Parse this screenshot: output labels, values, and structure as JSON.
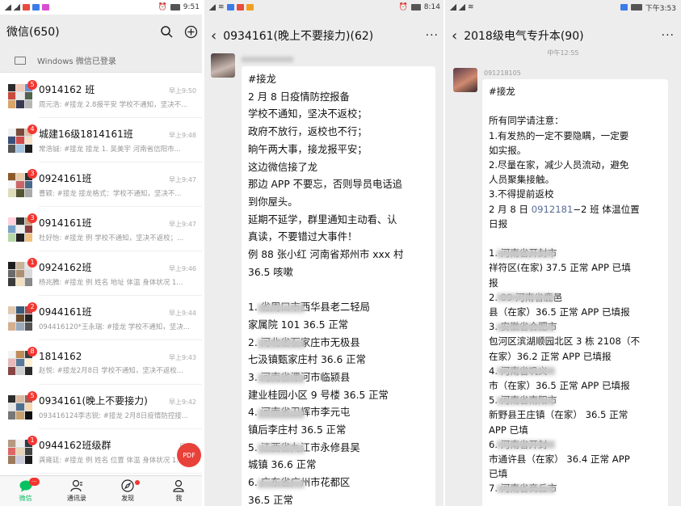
{
  "panel1": {
    "status_time": "9:51",
    "title": "微信(650)",
    "login_text": "Windows 微信已登录",
    "pdf_label": "PDF",
    "chats": [
      {
        "name": "0914162 班",
        "time": "早上9:50",
        "badge": "5",
        "preview": "周元浩: #接龙 2.8报平安 学校不通知，坚决不..."
      },
      {
        "name": "城建16级1814161班",
        "time": "早上9:48",
        "badge": "4",
        "preview": "常浩铖: #接龙 接龙 1. 吴美宇 河南省信阳市..."
      },
      {
        "name": "0924161班",
        "time": "早上9:47",
        "badge": "3",
        "preview": "曹颖: #接龙 接龙格式：学校不通知，坚决不..."
      },
      {
        "name": "0914161班",
        "time": "早上9:47",
        "badge": "3",
        "preview": "杜好怡: #接龙 例 学校不通知，坚决不返校；..."
      },
      {
        "name": "0924162班",
        "time": "早上9:46",
        "badge": "1",
        "preview": "杨兆腾: #接龙 例 姓名 地址 体温 身体状况 1..."
      },
      {
        "name": "0944161班",
        "time": "早上9:44",
        "badge": "2",
        "preview": "094416120*王永瑞: #接龙 学校不通知，坚决..."
      },
      {
        "name": "1814162",
        "time": "早上9:43",
        "badge": "8",
        "preview": "赵悦: #接龙2月8日 学校不通知，坚决不返校..."
      },
      {
        "name": "0934161(晚上不要接力)",
        "time": "早上9:42",
        "badge": "5",
        "preview": "093416124李志锐: #接龙 2月8日疫情防控接..."
      },
      {
        "name": "0944162班级群",
        "time": "早上9",
        "badge": "1",
        "preview": "龚雍廷: #接龙 例 姓名 位置 体温 身体状况 1..."
      }
    ],
    "tabs": [
      {
        "label": "微信",
        "badge": "···"
      },
      {
        "label": "通讯录"
      },
      {
        "label": "发现"
      },
      {
        "label": "我"
      }
    ]
  },
  "panel2": {
    "status_time": "8:14",
    "title": "0934161(晚上不要接力)(62)",
    "more": "···",
    "lines": [
      "#接龙",
      "2 月 8 日疫情防控报备",
      "学校不通知，坚决不返校；",
      "政府不放行，返校也不行；",
      "晌午两大事，接龙报平安；",
      "这边微信接了龙",
      "那边 APP 不要忘，否则导员电话追",
      "到你屋头。",
      "延期不延学，群里通知主动看、认",
      "真读，不要错过大事件！",
      "例 88 张小红 河南省郑州市 xxx 村",
      "36.5 咳嗽",
      "",
      "1.       省周口市西华县老二轻局",
      "家属院 101 36.5 正常",
      "2.         河北省石家庄市无极县",
      "七汲镇甄家庄村  36.6 正常",
      "3.           河南省漯河市临颍县",
      "建业桂园小区 9 号楼  36.5 正常",
      "4.           河南省卫辉市李元屯",
      "镇后李庄村 36.5 正常",
      "5.           江西省九江市永修县吴",
      "城镇 36.6 正常",
      "6.           广东省广州市花都区",
      "36.5 正常"
    ]
  },
  "panel3": {
    "status_time": "下午3:53",
    "title": "2018级电气专升本(90)",
    "more": "···",
    "time_label": "中午12:55",
    "sender": "091218105",
    "lines": [
      "#接龙",
      "",
      "所有同学请注意：",
      "1.有发热的一定不要隐瞒，一定要",
      "如实报。",
      "2.尽量在家，减少人员流动，避免",
      "人员聚集接触。",
      "3.不得提前返校",
      "2 月 8 日 0912181−2 班  体温位置",
      "日报",
      "",
      "1.              河南省开封市",
      "祥符区(在家) 37.5  正常  APP 已填",
      "报",
      "2. 09              河南省鹿邑",
      "县（在家）36.5 正常 APP 已填报",
      "3.                安徽省合肥市",
      "包河区滨湖顺园北区 3 栋 2108（不",
      "在家）36.2 正常  APP 已填报",
      "4.               河南省巩义",
      "市（在家）36.5 正常 APP 已填报",
      "5.              河南省南阳市",
      "新野县王庄镇（在家） 36.5 正常",
      "APP 已填",
      "6.               河南省开封",
      "市通许县（在家） 36.4 正常 APP",
      "已填",
      "7.              河南省商丘市"
    ]
  }
}
